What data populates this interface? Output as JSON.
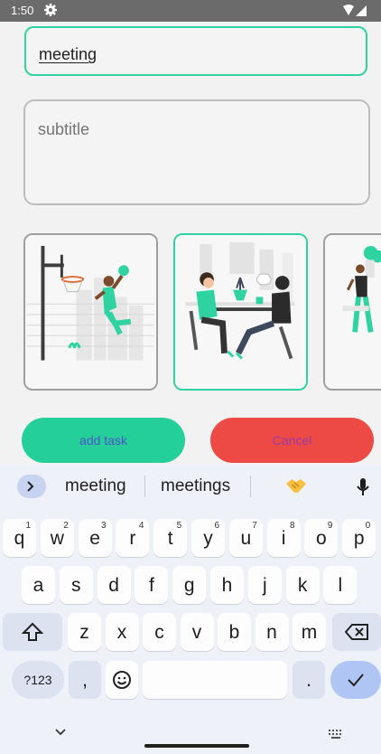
{
  "status": {
    "time": "1:50"
  },
  "form": {
    "title_value": "meeting",
    "subtitle_placeholder": "subtitle"
  },
  "images": [
    {
      "name": "basketball",
      "selected": false
    },
    {
      "name": "meeting",
      "selected": true
    },
    {
      "name": "walking-person",
      "selected": false
    }
  ],
  "buttons": {
    "add": "add task",
    "cancel": "Cancel"
  },
  "keyboard": {
    "suggestions": [
      "meeting",
      "meetings"
    ],
    "emoji_suggestion": "handshake",
    "row1": [
      {
        "k": "q",
        "n": "1"
      },
      {
        "k": "w",
        "n": "2"
      },
      {
        "k": "e",
        "n": "3"
      },
      {
        "k": "r",
        "n": "4"
      },
      {
        "k": "t",
        "n": "5"
      },
      {
        "k": "y",
        "n": "6"
      },
      {
        "k": "u",
        "n": "7"
      },
      {
        "k": "i",
        "n": "8"
      },
      {
        "k": "o",
        "n": "9"
      },
      {
        "k": "p",
        "n": "0"
      }
    ],
    "row2": [
      "a",
      "s",
      "d",
      "f",
      "g",
      "h",
      "j",
      "k",
      "l"
    ],
    "row3": [
      "z",
      "x",
      "c",
      "v",
      "b",
      "n",
      "m"
    ],
    "symbols_label": "?123",
    "comma": ",",
    "period": "."
  },
  "colors": {
    "accent": "#2ed3a1",
    "add_button": "#24cf9a",
    "cancel_button": "#ed4a45"
  }
}
